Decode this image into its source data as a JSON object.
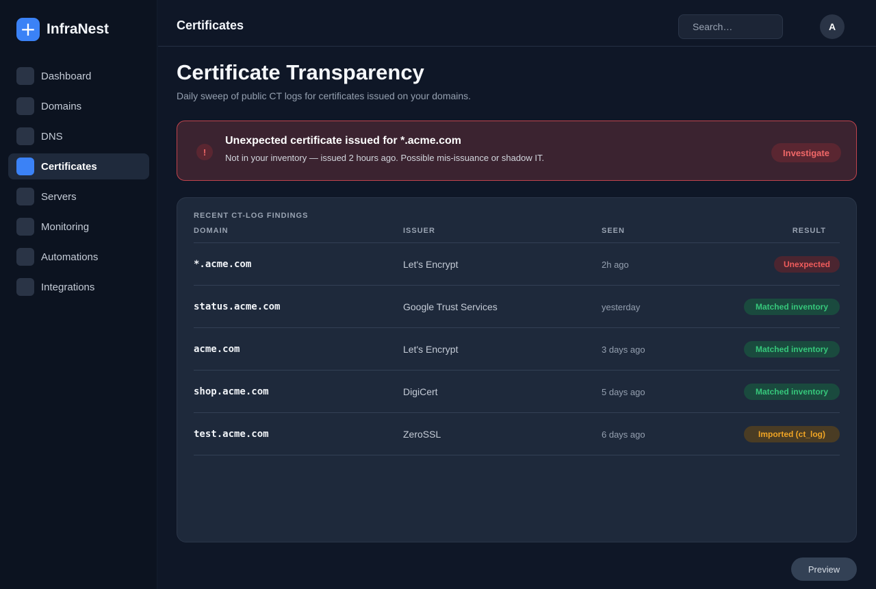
{
  "app": {
    "name": "InfraNest",
    "logo_icon": "plus-icon",
    "logo_glyph": "+"
  },
  "sidebar": {
    "items": [
      {
        "label": "Dashboard",
        "active": false
      },
      {
        "label": "Domains",
        "active": false
      },
      {
        "label": "DNS",
        "active": false
      },
      {
        "label": "Certificates",
        "active": true
      },
      {
        "label": "Servers",
        "active": false
      },
      {
        "label": "Monitoring",
        "active": false
      },
      {
        "label": "Automations",
        "active": false
      },
      {
        "label": "Integrations",
        "active": false
      }
    ]
  },
  "header": {
    "title": "Certificates",
    "search_placeholder": "Search…",
    "avatar_initial": "A"
  },
  "page": {
    "title": "Certificate Transparency",
    "subtitle": "Daily sweep of public CT logs for certificates issued on your domains."
  },
  "alert": {
    "icon": "exclamation-icon",
    "icon_glyph": "!",
    "title": "Unexpected certificate issued for *.acme.com",
    "text": "Not in your inventory — issued 2 hours ago. Possible mis-issuance or shadow IT.",
    "action_label": "Investigate"
  },
  "findings": {
    "title": "RECENT CT-LOG FINDINGS",
    "columns": {
      "domain": "DOMAIN",
      "issuer": "ISSUER",
      "seen": "SEEN",
      "result": "RESULT"
    },
    "rows": [
      {
        "domain": "*.acme.com",
        "issuer": "Let's Encrypt",
        "seen": "2h ago",
        "result": "Unexpected",
        "status": "danger"
      },
      {
        "domain": "status.acme.com",
        "issuer": "Google Trust Services",
        "seen": "yesterday",
        "result": "Matched inventory",
        "status": "success"
      },
      {
        "domain": "acme.com",
        "issuer": "Let's Encrypt",
        "seen": "3 days ago",
        "result": "Matched inventory",
        "status": "success"
      },
      {
        "domain": "shop.acme.com",
        "issuer": "DigiCert",
        "seen": "5 days ago",
        "result": "Matched inventory",
        "status": "success"
      },
      {
        "domain": "test.acme.com",
        "issuer": "ZeroSSL",
        "seen": "6 days ago",
        "result": "Imported (ct_log)",
        "status": "warning"
      }
    ]
  },
  "footer": {
    "preview_label": "Preview"
  },
  "colors": {
    "accent": "#3b82f6",
    "danger": "#f05c5c",
    "success": "#36c77b",
    "warning": "#f1a524"
  }
}
